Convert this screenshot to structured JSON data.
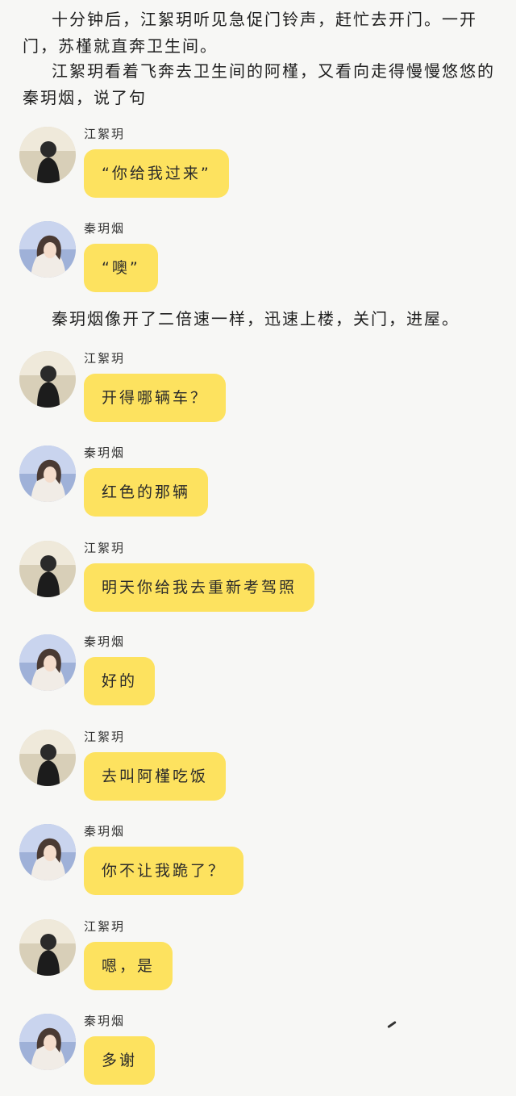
{
  "paragraphs": [
    "十分钟后，江絮玥听见急促门铃声，赶忙去开门。一开门，苏槿就直奔卫生间。",
    "江絮玥看着飞奔去卫生间的阿槿，又看向走得慢慢悠悠的秦玥烟，说了句",
    "秦玥烟像开了二倍速一样，迅速上楼，关门，进屋。"
  ],
  "messages": [
    {
      "sender": "江絮玥",
      "avatar": "dark-avatar-icon",
      "text": "“你给我过来”"
    },
    {
      "sender": "秦玥烟",
      "avatar": "blue-avatar-icon",
      "text": "“噢”"
    },
    {
      "sender": "江絮玥",
      "avatar": "dark-avatar-icon",
      "text": "开得哪辆车？"
    },
    {
      "sender": "秦玥烟",
      "avatar": "blue-avatar-icon",
      "text": "红色的那辆"
    },
    {
      "sender": "江絮玥",
      "avatar": "dark-avatar-icon",
      "text": "明天你给我去重新考驾照"
    },
    {
      "sender": "秦玥烟",
      "avatar": "blue-avatar-icon",
      "text": "好的"
    },
    {
      "sender": "江絮玥",
      "avatar": "dark-avatar-icon",
      "text": "去叫阿槿吃饭"
    },
    {
      "sender": "秦玥烟",
      "avatar": "blue-avatar-icon",
      "text": "你不让我跪了？"
    },
    {
      "sender": "江絮玥",
      "avatar": "dark-avatar-icon",
      "text": "嗯，是"
    },
    {
      "sender": "秦玥烟",
      "avatar": "blue-avatar-icon",
      "text": "多谢"
    }
  ],
  "colors": {
    "bubble": "#fde25f",
    "background": "#f7f7f5"
  }
}
